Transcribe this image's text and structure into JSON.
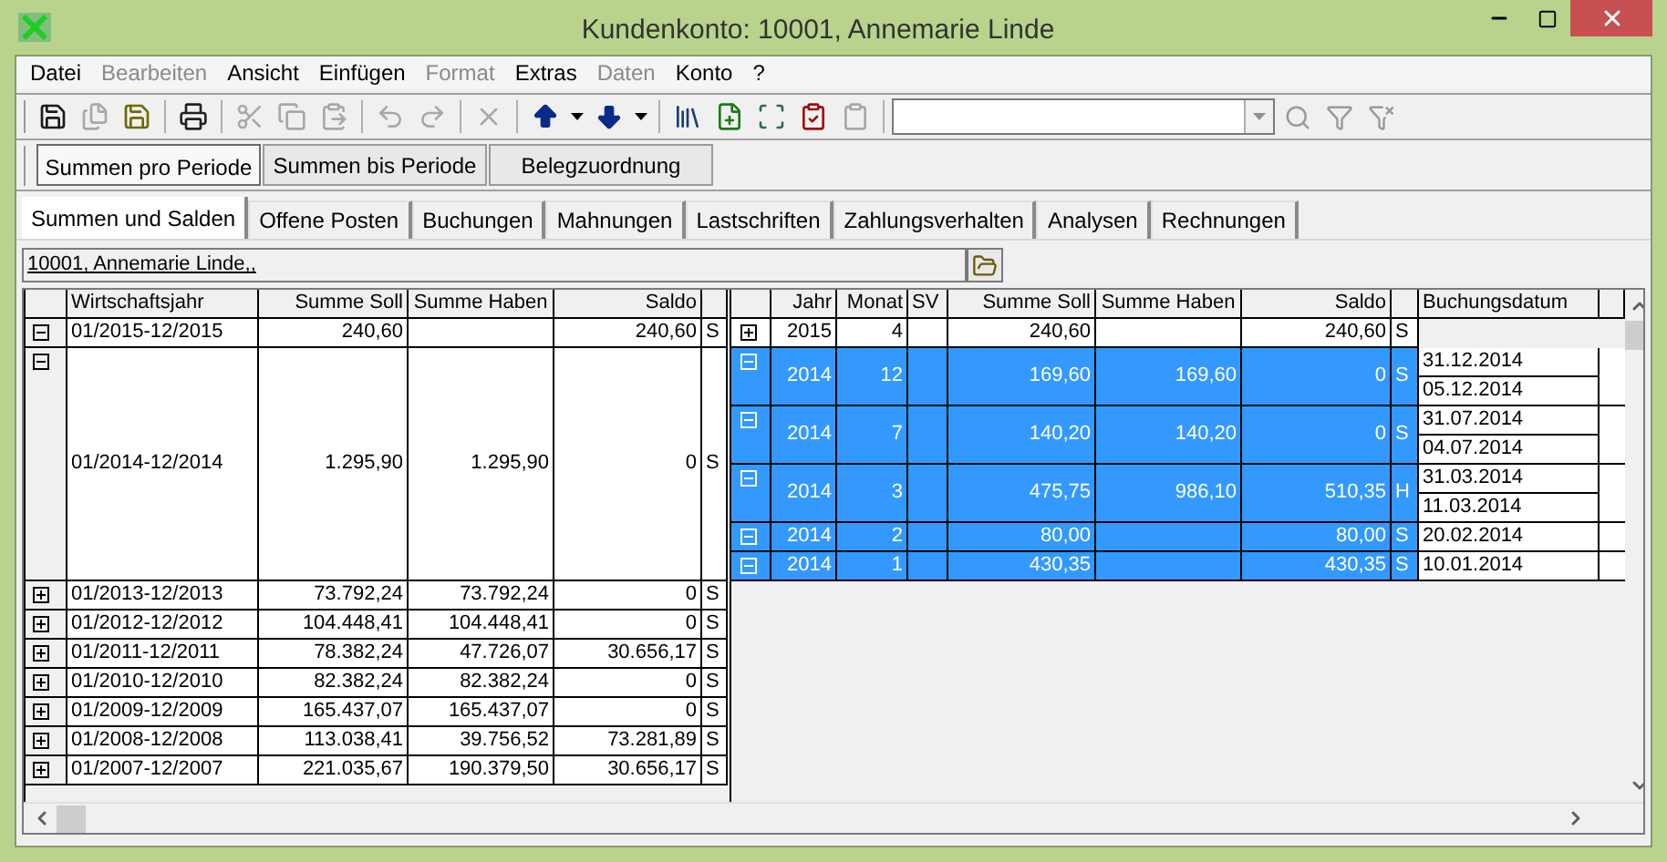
{
  "window": {
    "title": "Kundenkonto: 10001, Annemarie Linde"
  },
  "menu": [
    {
      "label": "Datei",
      "disabled": false
    },
    {
      "label": "Bearbeiten",
      "disabled": true
    },
    {
      "label": "Ansicht",
      "disabled": false
    },
    {
      "label": "Einfügen",
      "disabled": false
    },
    {
      "label": "Format",
      "disabled": true
    },
    {
      "label": "Extras",
      "disabled": false
    },
    {
      "label": "Daten",
      "disabled": true
    },
    {
      "label": "Konto",
      "disabled": false
    },
    {
      "label": "?",
      "disabled": false
    }
  ],
  "toolbar": {
    "groups": [
      [
        {
          "disabled": false
        },
        {
          "disabled": true
        },
        {
          "disabled": false
        }
      ],
      [
        {
          "disabled": false
        }
      ],
      [
        {
          "disabled": true
        },
        {
          "disabled": true
        },
        {
          "disabled": true
        }
      ],
      [
        {
          "disabled": true
        },
        {
          "disabled": true
        }
      ],
      [
        {
          "disabled": true
        }
      ],
      [
        {
          "disabled": false
        },
        {
          "disabled": false
        }
      ],
      [
        {
          "disabled": false
        },
        {
          "disabled": false
        },
        {
          "disabled": false
        },
        {
          "disabled": false
        },
        {
          "disabled": true
        }
      ]
    ],
    "search_tools": [
      {
        "disabled": true
      },
      {
        "disabled": true
      },
      {
        "disabled": true
      }
    ]
  },
  "view_buttons": [
    {
      "label": "Summen pro Periode",
      "selected": true
    },
    {
      "label": "Summen bis Periode",
      "selected": false
    },
    {
      "label": "Belegzuordnung",
      "selected": false
    }
  ],
  "tabs": [
    {
      "label": "Summen und Salden",
      "selected": true
    },
    {
      "label": "Offene Posten",
      "selected": false
    },
    {
      "label": "Buchungen",
      "selected": false
    },
    {
      "label": "Mahnungen",
      "selected": false
    },
    {
      "label": "Lastschriften",
      "selected": false
    },
    {
      "label": "Zahlungsverhalten",
      "selected": false
    },
    {
      "label": "Analysen",
      "selected": false
    },
    {
      "label": "Rechnungen",
      "selected": false
    }
  ],
  "account": {
    "value": "10001, Annemarie Linde,,"
  },
  "left_table": {
    "columns": [
      "Wirtschaftsjahr",
      "Summe Soll",
      "Summe Haben",
      "Saldo"
    ],
    "rows": [
      {
        "expanded": true,
        "period": "01/2015-12/2015",
        "soll": "240,60",
        "saldo": "240,60",
        "side": "S",
        "children": [
          {
            "expanded": false,
            "selected": false,
            "year": "2015",
            "month": "4",
            "soll": "240,60",
            "saldo": "240,60",
            "side": "S"
          }
        ]
      },
      {
        "expanded": true,
        "period": "01/2014-12/2014",
        "soll": "1.295,90",
        "haben": "1.295,90",
        "saldo": "0",
        "side": "S",
        "children": [
          {
            "expanded": true,
            "selected": true,
            "year": "2014",
            "month": "12",
            "soll": "169,60",
            "haben": "169,60",
            "saldo": "0",
            "side": "S",
            "dates": [
              "31.12.2014",
              "05.12.2014"
            ]
          },
          {
            "expanded": true,
            "selected": true,
            "year": "2014",
            "month": "7",
            "soll": "140,20",
            "haben": "140,20",
            "saldo": "0",
            "side": "S",
            "dates": [
              "31.07.2014",
              "04.07.2014"
            ]
          },
          {
            "expanded": true,
            "selected": true,
            "year": "2014",
            "month": "3",
            "soll": "475,75",
            "haben": "986,10",
            "saldo": "510,35",
            "side": "H",
            "dates": [
              "31.03.2014",
              "11.03.2014"
            ]
          },
          {
            "expanded": true,
            "selected": true,
            "year": "2014",
            "month": "2",
            "soll": "80,00",
            "saldo": "80,00",
            "side": "S",
            "dates": [
              "20.02.2014"
            ]
          },
          {
            "expanded": true,
            "selected": true,
            "year": "2014",
            "month": "1",
            "soll": "430,35",
            "saldo": "430,35",
            "side": "S",
            "dates": [
              "10.01.2014"
            ]
          }
        ]
      },
      {
        "expanded": false,
        "period": "01/2013-12/2013",
        "soll": "73.792,24",
        "haben": "73.792,24",
        "saldo": "0",
        "side": "S"
      },
      {
        "expanded": false,
        "period": "01/2012-12/2012",
        "soll": "104.448,41",
        "haben": "104.448,41",
        "saldo": "0",
        "side": "S"
      },
      {
        "expanded": false,
        "period": "01/2011-12/2011",
        "soll": "78.382,24",
        "haben": "47.726,07",
        "saldo": "30.656,17",
        "side": "S"
      },
      {
        "expanded": false,
        "period": "01/2010-12/2010",
        "soll": "82.382,24",
        "haben": "82.382,24",
        "saldo": "0",
        "side": "S"
      },
      {
        "expanded": false,
        "period": "01/2009-12/2009",
        "soll": "165.437,07",
        "haben": "165.437,07",
        "saldo": "0",
        "side": "S"
      },
      {
        "expanded": false,
        "period": "01/2008-12/2008",
        "soll": "113.038,41",
        "haben": "39.756,52",
        "saldo": "73.281,89",
        "side": "S"
      },
      {
        "expanded": false,
        "period": "01/2007-12/2007",
        "soll": "221.035,67",
        "haben": "190.379,50",
        "saldo": "30.656,17",
        "side": "S"
      }
    ]
  },
  "right_table": {
    "columns": [
      "Jahr",
      "Monat",
      "SV",
      "Summe Soll",
      "Summe Haben",
      "Saldo",
      "Buchungsdatum"
    ]
  }
}
